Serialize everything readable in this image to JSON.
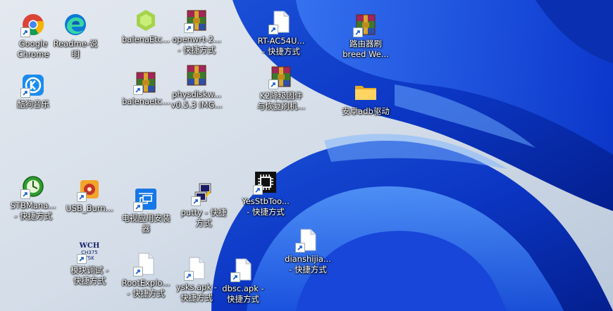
{
  "desktop": {
    "icons": [
      {
        "id": "chrome",
        "label": "Google\nChrome",
        "icon": "chrome-icon",
        "shortcut": true
      },
      {
        "id": "readme",
        "label": "Readme-说\n明",
        "icon": "edge-icon",
        "shortcut": false
      },
      {
        "id": "balenaetcher1",
        "label": "balenaEtc...",
        "icon": "hex-green-icon",
        "shortcut": false
      },
      {
        "id": "openwrt",
        "label": "openwrt-2...\n- 快捷方式",
        "icon": "winrar-icon",
        "shortcut": true
      },
      {
        "id": "rtac54u",
        "label": "RT-AC54U...\n- 快捷方式",
        "icon": "file-icon",
        "shortcut": true
      },
      {
        "id": "router",
        "label": "路由器刷\nbreed We...",
        "icon": "winrar-icon",
        "shortcut": true
      },
      {
        "id": "kugou",
        "label": "酷狗音乐",
        "icon": "kugou-icon",
        "shortcut": true
      },
      {
        "id": "balenaetcher2",
        "label": "balenaetc...",
        "icon": "winrar-icon",
        "shortcut": true
      },
      {
        "id": "physdisk",
        "label": "physdiskw...\nv0.5.3 IMG...",
        "icon": "winrar-icon",
        "shortcut": false
      },
      {
        "id": "k2",
        "label": "K2降级固件\n与恢复刷机...",
        "icon": "winrar-icon",
        "shortcut": true
      },
      {
        "id": "adb",
        "label": "安卓adb驱动",
        "icon": "folder-icon",
        "shortcut": false
      },
      {
        "id": "stbmanager",
        "label": "STBMana...\n- 快捷方式",
        "icon": "stb-icon",
        "shortcut": true
      },
      {
        "id": "usbburn",
        "label": "USB_Burn...",
        "icon": "usb-burn-icon",
        "shortcut": true
      },
      {
        "id": "tvinstaller",
        "label": "电视应用安装\n器",
        "icon": "tv-installer-icon",
        "shortcut": true
      },
      {
        "id": "putty",
        "label": "putty - 快捷\n方式",
        "icon": "putty-icon",
        "shortcut": true
      },
      {
        "id": "yesstb",
        "label": "YesStbToo...\n- 快捷方式",
        "icon": "chip-icon",
        "shortcut": true
      },
      {
        "id": "dianshijia",
        "label": "dianshijia...\n- 快捷方式",
        "icon": "file-icon",
        "shortcut": true
      },
      {
        "id": "module",
        "label": "模块调试 -\n快捷方式",
        "icon": "wch-icon",
        "shortcut": true
      },
      {
        "id": "rootexplorer",
        "label": "RootExplo...\n- 快捷方式",
        "icon": "file-icon",
        "shortcut": true
      },
      {
        "id": "ysks",
        "label": "ysks.apk -\n快捷方式",
        "icon": "file-icon",
        "shortcut": true
      },
      {
        "id": "dbsc",
        "label": "dbsc.apk -\n快捷方式",
        "icon": "file-icon",
        "shortcut": true
      }
    ]
  },
  "wch_text": "WCH"
}
